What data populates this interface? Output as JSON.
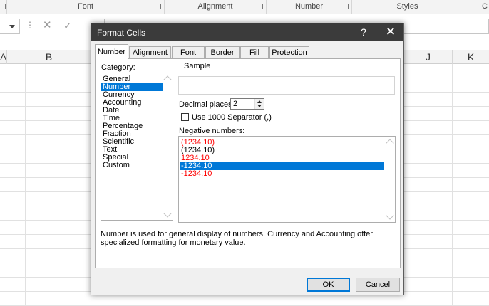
{
  "ribbon": {
    "groups": [
      {
        "label": "Font"
      },
      {
        "label": "Alignment"
      },
      {
        "label": "Number"
      },
      {
        "label": "Styles"
      },
      {
        "label": "C"
      }
    ]
  },
  "columns": [
    "A",
    "B",
    "J",
    "K"
  ],
  "dialog": {
    "title": "Format Cells",
    "help_glyph": "?",
    "close_glyph": "✕",
    "tabs": [
      "Number",
      "Alignment",
      "Font",
      "Border",
      "Fill",
      "Protection"
    ],
    "active_tab": "Number",
    "category_label": "Category:",
    "categories": [
      "General",
      "Number",
      "Currency",
      "Accounting",
      "Date",
      "Time",
      "Percentage",
      "Fraction",
      "Scientific",
      "Text",
      "Special",
      "Custom"
    ],
    "selected_category": "Number",
    "sample_label": "Sample",
    "decimal_places_label": "Decimal places:",
    "decimal_places_value": "2",
    "separator_label": "Use 1000 Separator (,)",
    "separator_checked": false,
    "negative_numbers_label": "Negative numbers:",
    "negative_numbers": [
      {
        "text": "(1234.10)",
        "color": "#ff0000"
      },
      {
        "text": "(1234.10)",
        "color": "#000000"
      },
      {
        "text": "1234.10",
        "color": "#ff0000"
      },
      {
        "text": "-1234.10",
        "color": "#000000"
      },
      {
        "text": "-1234.10",
        "color": "#ff0000"
      }
    ],
    "selected_negative_index": 3,
    "description": "Number is used for general display of numbers.  Currency and Accounting offer specialized formatting for monetary value.",
    "ok_label": "OK",
    "cancel_label": "Cancel"
  },
  "colors": {
    "accent": "#0078d7",
    "titlebar": "#3b3b3b",
    "dialog_bg": "#f0f0f0",
    "negative_red": "#ff0000"
  }
}
